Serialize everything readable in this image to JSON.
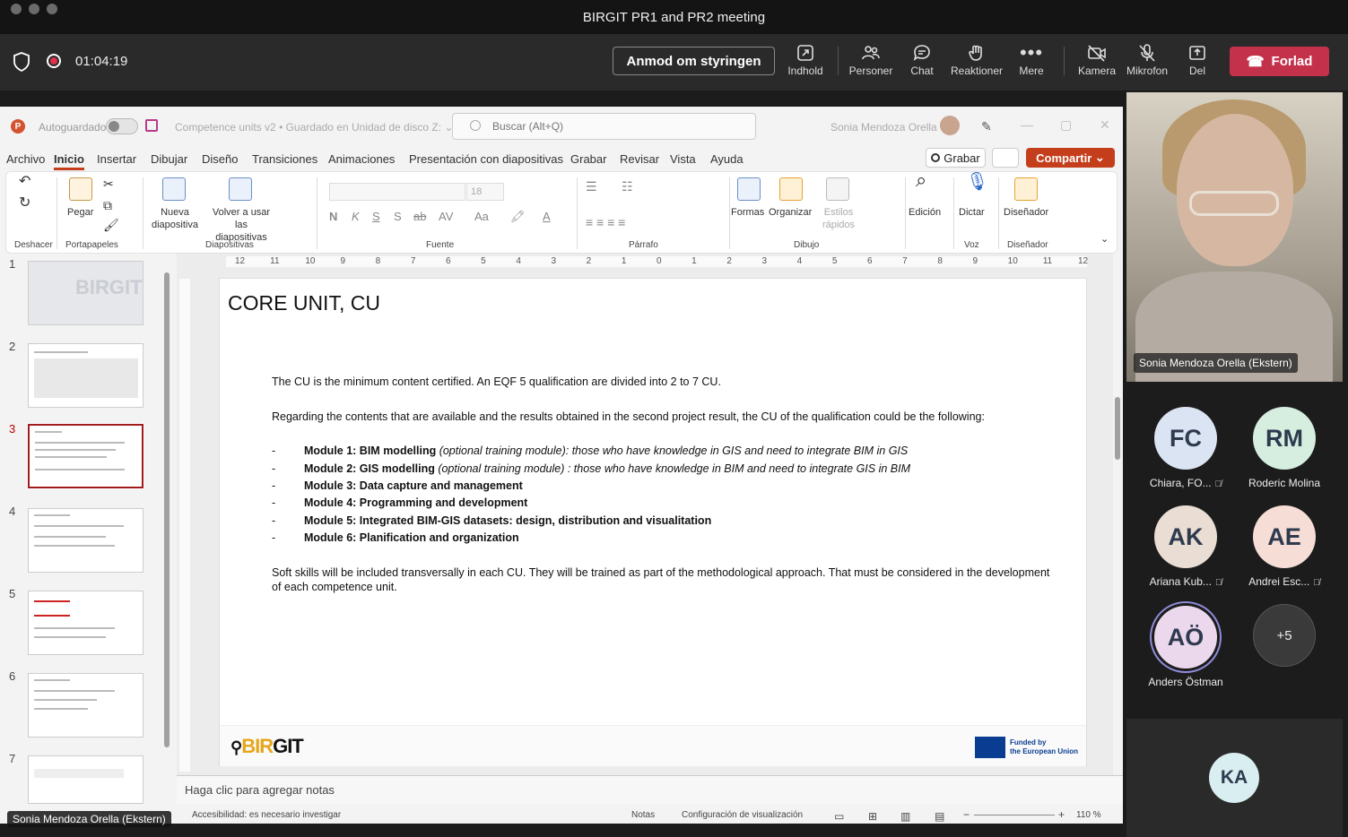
{
  "window": {
    "title": "BIRGIT PR1 and PR2 meeting"
  },
  "meeting": {
    "timer": "01:04:19",
    "request_control": "Anmod om styringen",
    "toolbar": [
      {
        "label": "Indhold",
        "icon": "share-content-icon"
      },
      {
        "label": "Personer",
        "icon": "people-icon"
      },
      {
        "label": "Chat",
        "icon": "chat-icon"
      },
      {
        "label": "Reaktioner",
        "icon": "reactions-icon"
      },
      {
        "label": "Mere",
        "icon": "more-icon"
      },
      {
        "label": "Kamera",
        "icon": "camera-off-icon"
      },
      {
        "label": "Mikrofon",
        "icon": "mic-off-icon"
      },
      {
        "label": "Del",
        "icon": "share-icon"
      }
    ],
    "leave": "Forlad"
  },
  "ppt": {
    "autosave": "Autoguardado",
    "doc": "Competence units v2 • Guardado en Unidad de disco Z: ⌄",
    "search_placeholder": "Buscar (Alt+Q)",
    "user": "Sonia  Mendoza Orella",
    "menus": [
      "Archivo",
      "Inicio",
      "Insertar",
      "Dibujar",
      "Diseño",
      "Transiciones",
      "Animaciones",
      "Presentación con diapositivas",
      "Grabar",
      "Revisar",
      "Vista",
      "Ayuda"
    ],
    "grabar": "Grabar",
    "compartir": "Compartir",
    "ribbon": {
      "deshacer": "Deshacer",
      "pegar": "Pegar",
      "portapapeles": "Portapapeles",
      "nueva": "Nueva diapositiva",
      "volver": "Volver a usar las diapositivas",
      "diapositivas": "Diapositivas",
      "font_size": "18",
      "fuente": "Fuente",
      "parrafo": "Párrafo",
      "formas": "Formas",
      "organizar": "Organizar",
      "estilos": "Estilos rápidos",
      "dibujo": "Dibujo",
      "edicion": "Edición",
      "dictar": "Dictar",
      "voz": "Voz",
      "disenador": "Diseñador",
      "disenador_group": "Diseñador"
    },
    "thumbnails": [
      "1",
      "2",
      "3",
      "4",
      "5",
      "6",
      "7"
    ],
    "ruler": [
      "12",
      "11",
      "10",
      "9",
      "8",
      "7",
      "6",
      "5",
      "4",
      "3",
      "2",
      "1",
      "0",
      "1",
      "2",
      "3",
      "4",
      "5",
      "6",
      "7",
      "8",
      "9",
      "10",
      "11",
      "12"
    ],
    "slide": {
      "title": "CORE UNIT, CU",
      "p1": "The CU is the minimum content certified. An EQF 5 qualification are divided into 2 to 7 CU.",
      "p2": "Regarding the contents that are available and the results obtained in the second project result, the CU of the qualification could be the following:",
      "modules": [
        {
          "bold": "Module 1: BIM modelling",
          "italic": " (optional training module): those who have knowledge in GIS and need to integrate BIM in GIS"
        },
        {
          "bold": "Module 2: GIS modelling",
          "italic": " (optional training module) : those who have knowledge in BIM and need to integrate GIS in BIM"
        },
        {
          "bold": "Module 3: Data capture and management",
          "italic": ""
        },
        {
          "bold": "Module 4: Programming and development",
          "italic": ""
        },
        {
          "bold": "Module 5: Integrated BIM-GIS datasets: design, distribution and visualitation",
          "italic": ""
        },
        {
          "bold": "Module 6: Planification and organization",
          "italic": ""
        }
      ],
      "dash": "-",
      "p3": "Soft skills will be included transversally in each CU. They will be trained as part of the methodological approach. That must be considered in the development of each competence unit.",
      "logo_left": "BIR",
      "logo_right": "GIT",
      "eu_text_1": "Funded by",
      "eu_text_2": "the European Union"
    },
    "notes": "Haga clic para agregar notas",
    "status": {
      "accessibility": "Accesibilidad: es necesario investigar",
      "notas": "Notas",
      "config": "Configuración de visualización",
      "zoom": "110 %"
    }
  },
  "speaker_tag": "Sonia Mendoza Orella (Ekstern)",
  "video_name": "Sonia Mendoza Orella (Ekstern)",
  "participants": [
    {
      "initials": "FC",
      "name": "Chiara, FO...",
      "bg": "#dbe4f2",
      "muted": true
    },
    {
      "initials": "RM",
      "name": "Roderic Molina",
      "bg": "#d6eee0",
      "muted": false
    },
    {
      "initials": "AK",
      "name": "Ariana Kub...",
      "bg": "#e9ddd4",
      "muted": true
    },
    {
      "initials": "AE",
      "name": "Andrei Esc...",
      "bg": "#f6ddd6",
      "muted": true
    },
    {
      "initials": "AÖ",
      "name": "Anders Östman",
      "bg": "#ecd8ec",
      "muted": false
    },
    {
      "initials": "+5",
      "name": "",
      "bg": "#3a3a3a",
      "muted": false
    }
  ],
  "extra_participant": {
    "initials": "KA",
    "bg": "#d8eef0"
  }
}
